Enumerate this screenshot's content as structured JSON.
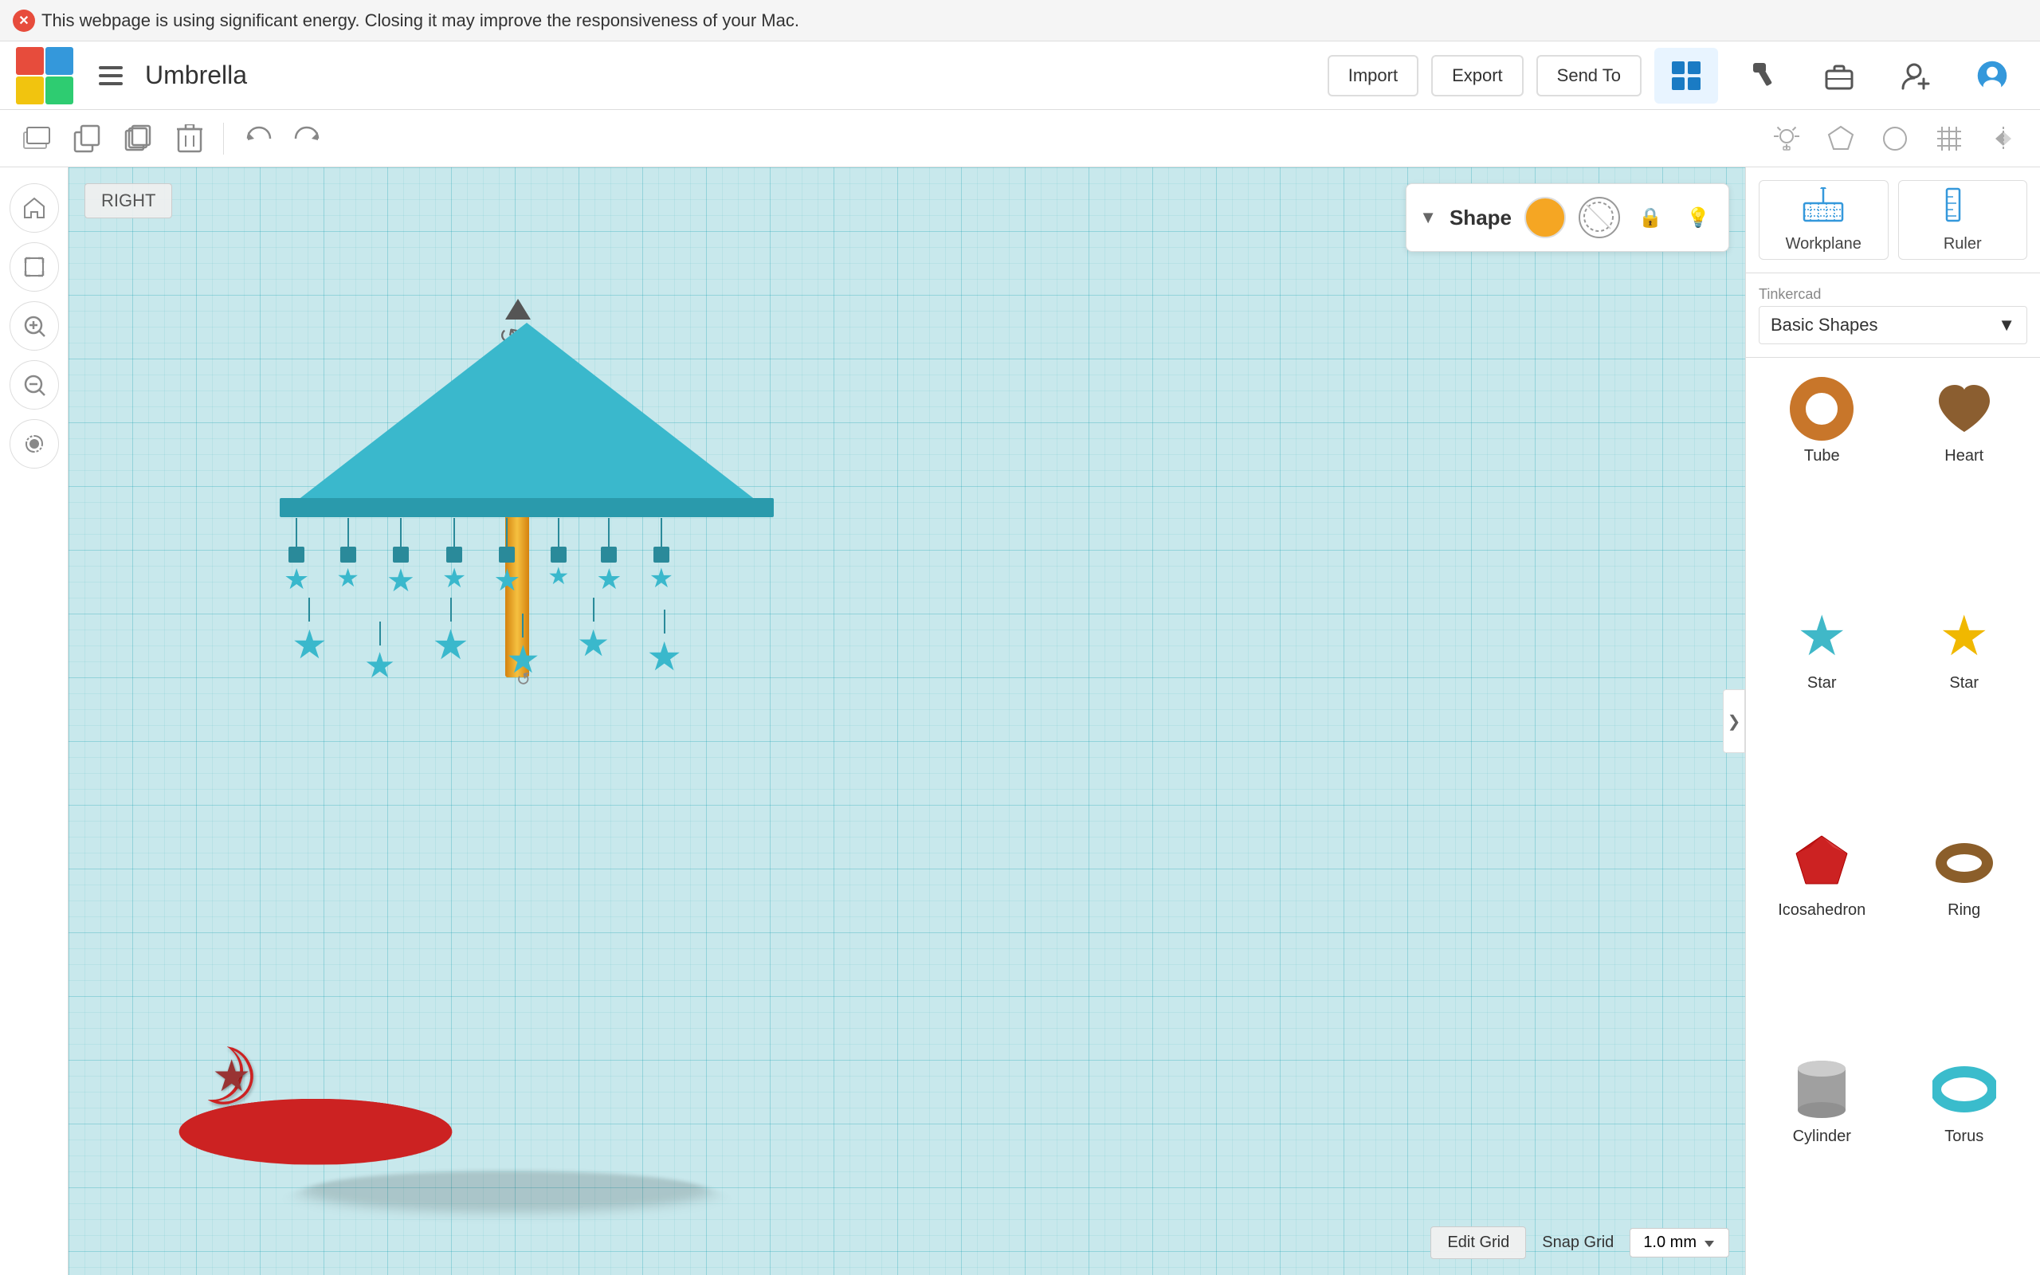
{
  "notification": {
    "text": "This webpage is using significant energy. Closing it may improve the responsiveness of your Mac."
  },
  "header": {
    "title": "Umbrella",
    "logo_cells": [
      "R",
      "B",
      "Y",
      "G"
    ],
    "menu_icon": "≡",
    "nav_buttons": [
      {
        "name": "grid-view",
        "icon": "⊞",
        "active": true
      },
      {
        "name": "hammer",
        "icon": "🔨",
        "active": false
      },
      {
        "name": "briefcase",
        "icon": "💼",
        "active": false
      },
      {
        "name": "add-person",
        "icon": "👤+",
        "active": false
      },
      {
        "name": "profile",
        "icon": "👤",
        "active": false
      }
    ],
    "import_label": "Import",
    "export_label": "Export",
    "send_to_label": "Send To"
  },
  "toolbar": {
    "tools": [
      {
        "name": "new-workplane",
        "icon": "⬜"
      },
      {
        "name": "copy",
        "icon": "⧉"
      },
      {
        "name": "duplicate",
        "icon": "❐"
      },
      {
        "name": "delete",
        "icon": "🗑"
      },
      {
        "name": "undo",
        "icon": "↩"
      },
      {
        "name": "redo",
        "icon": "↪"
      }
    ],
    "right_tools": [
      {
        "name": "light-bulb",
        "icon": "💡"
      },
      {
        "name": "polygon",
        "icon": "⬟"
      },
      {
        "name": "circle",
        "icon": "○"
      },
      {
        "name": "grid",
        "icon": "⊞"
      },
      {
        "name": "mirror",
        "icon": "⇔"
      }
    ]
  },
  "shape_panel": {
    "title": "Shape",
    "arrow": "▼",
    "color_orange": "#f5a623",
    "color_hole": "hole",
    "icon_lock": "🔒",
    "icon_light": "💡"
  },
  "right_panel": {
    "workplane_label": "Workplane",
    "ruler_label": "Ruler",
    "library": {
      "provider": "Tinkercad",
      "category": "Basic Shapes",
      "dropdown_arrow": "▼"
    },
    "shapes": [
      {
        "name": "Tube",
        "thumb": "tube"
      },
      {
        "name": "Heart",
        "thumb": "heart"
      },
      {
        "name": "Star",
        "thumb": "star-cyan"
      },
      {
        "name": "Star",
        "thumb": "star-yellow"
      },
      {
        "name": "Icosahedron",
        "thumb": "icosahedron"
      },
      {
        "name": "Ring",
        "thumb": "ring"
      },
      {
        "name": "Cylinder",
        "thumb": "cylinder"
      },
      {
        "name": "Torus",
        "thumb": "torus-teal"
      }
    ]
  },
  "canvas": {
    "view_label": "RIGHT",
    "snap_grid_label": "Snap Grid",
    "snap_grid_value": "1.0 mm",
    "edit_grid_label": "Edit Grid"
  }
}
